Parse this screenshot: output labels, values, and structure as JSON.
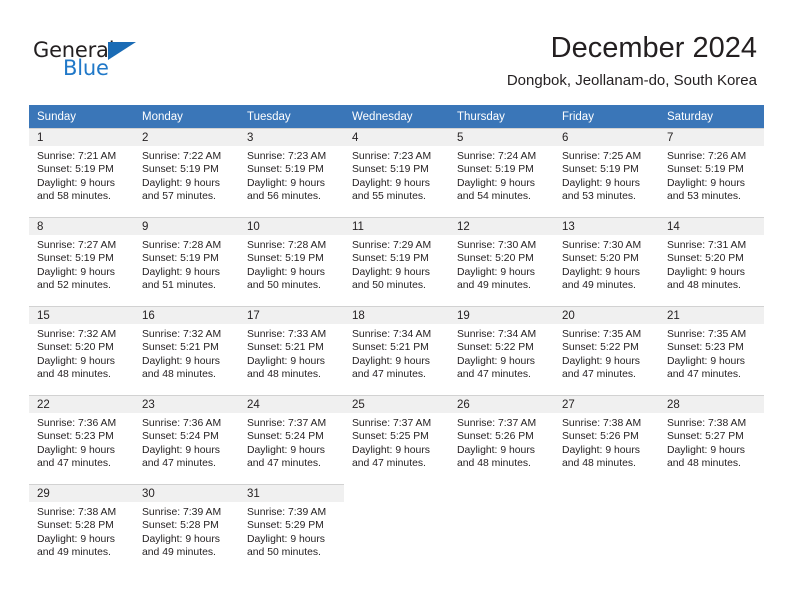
{
  "logo": {
    "word_top": "General",
    "word_bottom": "Blue",
    "triangle_color": "#1a6bb5",
    "blue_text_color": "#2078c8"
  },
  "header": {
    "title": "December 2024",
    "subtitle": "Dongbok, Jeollanam-do, South Korea",
    "header_bg_color": "#3a76b8"
  },
  "calendar": {
    "weekday_headers": [
      "Sunday",
      "Monday",
      "Tuesday",
      "Wednesday",
      "Thursday",
      "Friday",
      "Saturday"
    ],
    "weeks": [
      [
        {
          "day": "1",
          "sunrise": "Sunrise: 7:21 AM",
          "sunset": "Sunset: 5:19 PM",
          "daylight_line1": "Daylight: 9 hours",
          "daylight_line2": "and 58 minutes."
        },
        {
          "day": "2",
          "sunrise": "Sunrise: 7:22 AM",
          "sunset": "Sunset: 5:19 PM",
          "daylight_line1": "Daylight: 9 hours",
          "daylight_line2": "and 57 minutes."
        },
        {
          "day": "3",
          "sunrise": "Sunrise: 7:23 AM",
          "sunset": "Sunset: 5:19 PM",
          "daylight_line1": "Daylight: 9 hours",
          "daylight_line2": "and 56 minutes."
        },
        {
          "day": "4",
          "sunrise": "Sunrise: 7:23 AM",
          "sunset": "Sunset: 5:19 PM",
          "daylight_line1": "Daylight: 9 hours",
          "daylight_line2": "and 55 minutes."
        },
        {
          "day": "5",
          "sunrise": "Sunrise: 7:24 AM",
          "sunset": "Sunset: 5:19 PM",
          "daylight_line1": "Daylight: 9 hours",
          "daylight_line2": "and 54 minutes."
        },
        {
          "day": "6",
          "sunrise": "Sunrise: 7:25 AM",
          "sunset": "Sunset: 5:19 PM",
          "daylight_line1": "Daylight: 9 hours",
          "daylight_line2": "and 53 minutes."
        },
        {
          "day": "7",
          "sunrise": "Sunrise: 7:26 AM",
          "sunset": "Sunset: 5:19 PM",
          "daylight_line1": "Daylight: 9 hours",
          "daylight_line2": "and 53 minutes."
        }
      ],
      [
        {
          "day": "8",
          "sunrise": "Sunrise: 7:27 AM",
          "sunset": "Sunset: 5:19 PM",
          "daylight_line1": "Daylight: 9 hours",
          "daylight_line2": "and 52 minutes."
        },
        {
          "day": "9",
          "sunrise": "Sunrise: 7:28 AM",
          "sunset": "Sunset: 5:19 PM",
          "daylight_line1": "Daylight: 9 hours",
          "daylight_line2": "and 51 minutes."
        },
        {
          "day": "10",
          "sunrise": "Sunrise: 7:28 AM",
          "sunset": "Sunset: 5:19 PM",
          "daylight_line1": "Daylight: 9 hours",
          "daylight_line2": "and 50 minutes."
        },
        {
          "day": "11",
          "sunrise": "Sunrise: 7:29 AM",
          "sunset": "Sunset: 5:19 PM",
          "daylight_line1": "Daylight: 9 hours",
          "daylight_line2": "and 50 minutes."
        },
        {
          "day": "12",
          "sunrise": "Sunrise: 7:30 AM",
          "sunset": "Sunset: 5:20 PM",
          "daylight_line1": "Daylight: 9 hours",
          "daylight_line2": "and 49 minutes."
        },
        {
          "day": "13",
          "sunrise": "Sunrise: 7:30 AM",
          "sunset": "Sunset: 5:20 PM",
          "daylight_line1": "Daylight: 9 hours",
          "daylight_line2": "and 49 minutes."
        },
        {
          "day": "14",
          "sunrise": "Sunrise: 7:31 AM",
          "sunset": "Sunset: 5:20 PM",
          "daylight_line1": "Daylight: 9 hours",
          "daylight_line2": "and 48 minutes."
        }
      ],
      [
        {
          "day": "15",
          "sunrise": "Sunrise: 7:32 AM",
          "sunset": "Sunset: 5:20 PM",
          "daylight_line1": "Daylight: 9 hours",
          "daylight_line2": "and 48 minutes."
        },
        {
          "day": "16",
          "sunrise": "Sunrise: 7:32 AM",
          "sunset": "Sunset: 5:21 PM",
          "daylight_line1": "Daylight: 9 hours",
          "daylight_line2": "and 48 minutes."
        },
        {
          "day": "17",
          "sunrise": "Sunrise: 7:33 AM",
          "sunset": "Sunset: 5:21 PM",
          "daylight_line1": "Daylight: 9 hours",
          "daylight_line2": "and 48 minutes."
        },
        {
          "day": "18",
          "sunrise": "Sunrise: 7:34 AM",
          "sunset": "Sunset: 5:21 PM",
          "daylight_line1": "Daylight: 9 hours",
          "daylight_line2": "and 47 minutes."
        },
        {
          "day": "19",
          "sunrise": "Sunrise: 7:34 AM",
          "sunset": "Sunset: 5:22 PM",
          "daylight_line1": "Daylight: 9 hours",
          "daylight_line2": "and 47 minutes."
        },
        {
          "day": "20",
          "sunrise": "Sunrise: 7:35 AM",
          "sunset": "Sunset: 5:22 PM",
          "daylight_line1": "Daylight: 9 hours",
          "daylight_line2": "and 47 minutes."
        },
        {
          "day": "21",
          "sunrise": "Sunrise: 7:35 AM",
          "sunset": "Sunset: 5:23 PM",
          "daylight_line1": "Daylight: 9 hours",
          "daylight_line2": "and 47 minutes."
        }
      ],
      [
        {
          "day": "22",
          "sunrise": "Sunrise: 7:36 AM",
          "sunset": "Sunset: 5:23 PM",
          "daylight_line1": "Daylight: 9 hours",
          "daylight_line2": "and 47 minutes."
        },
        {
          "day": "23",
          "sunrise": "Sunrise: 7:36 AM",
          "sunset": "Sunset: 5:24 PM",
          "daylight_line1": "Daylight: 9 hours",
          "daylight_line2": "and 47 minutes."
        },
        {
          "day": "24",
          "sunrise": "Sunrise: 7:37 AM",
          "sunset": "Sunset: 5:24 PM",
          "daylight_line1": "Daylight: 9 hours",
          "daylight_line2": "and 47 minutes."
        },
        {
          "day": "25",
          "sunrise": "Sunrise: 7:37 AM",
          "sunset": "Sunset: 5:25 PM",
          "daylight_line1": "Daylight: 9 hours",
          "daylight_line2": "and 47 minutes."
        },
        {
          "day": "26",
          "sunrise": "Sunrise: 7:37 AM",
          "sunset": "Sunset: 5:26 PM",
          "daylight_line1": "Daylight: 9 hours",
          "daylight_line2": "and 48 minutes."
        },
        {
          "day": "27",
          "sunrise": "Sunrise: 7:38 AM",
          "sunset": "Sunset: 5:26 PM",
          "daylight_line1": "Daylight: 9 hours",
          "daylight_line2": "and 48 minutes."
        },
        {
          "day": "28",
          "sunrise": "Sunrise: 7:38 AM",
          "sunset": "Sunset: 5:27 PM",
          "daylight_line1": "Daylight: 9 hours",
          "daylight_line2": "and 48 minutes."
        }
      ],
      [
        {
          "day": "29",
          "sunrise": "Sunrise: 7:38 AM",
          "sunset": "Sunset: 5:28 PM",
          "daylight_line1": "Daylight: 9 hours",
          "daylight_line2": "and 49 minutes."
        },
        {
          "day": "30",
          "sunrise": "Sunrise: 7:39 AM",
          "sunset": "Sunset: 5:28 PM",
          "daylight_line1": "Daylight: 9 hours",
          "daylight_line2": "and 49 minutes."
        },
        {
          "day": "31",
          "sunrise": "Sunrise: 7:39 AM",
          "sunset": "Sunset: 5:29 PM",
          "daylight_line1": "Daylight: 9 hours",
          "daylight_line2": "and 50 minutes."
        },
        {
          "day": "",
          "sunrise": "",
          "sunset": "",
          "daylight_line1": "",
          "daylight_line2": ""
        },
        {
          "day": "",
          "sunrise": "",
          "sunset": "",
          "daylight_line1": "",
          "daylight_line2": ""
        },
        {
          "day": "",
          "sunrise": "",
          "sunset": "",
          "daylight_line1": "",
          "daylight_line2": ""
        },
        {
          "day": "",
          "sunrise": "",
          "sunset": "",
          "daylight_line1": "",
          "daylight_line2": ""
        }
      ]
    ]
  }
}
